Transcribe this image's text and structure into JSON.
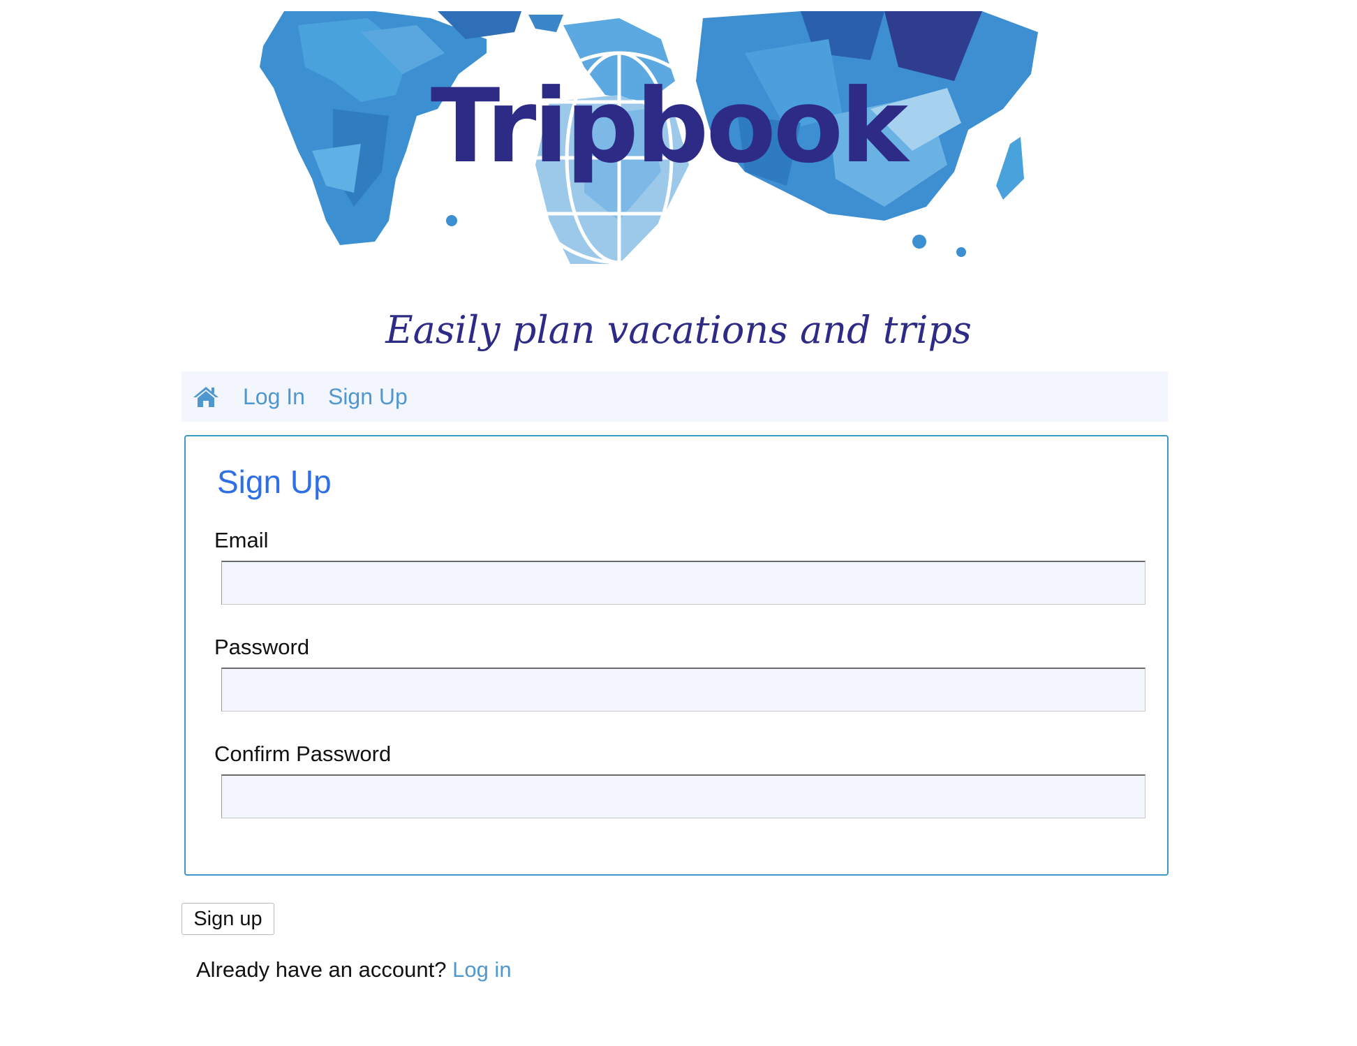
{
  "banner": {
    "logo_text": "Tripbook",
    "tagline": "Easily plan vacations and trips"
  },
  "nav": {
    "home_icon": "home-icon",
    "links": [
      {
        "label": "Log In"
      },
      {
        "label": "Sign Up"
      }
    ]
  },
  "form": {
    "title": "Sign Up",
    "fields": [
      {
        "label": "Email",
        "value": "",
        "placeholder": ""
      },
      {
        "label": "Password",
        "value": "",
        "placeholder": ""
      },
      {
        "label": "Confirm Password",
        "value": "",
        "placeholder": ""
      }
    ],
    "submit_label": "Sign up"
  },
  "footer": {
    "prompt": "Already have an account?",
    "link_label": "Log in"
  },
  "colors": {
    "brand_navy": "#2d2b86",
    "link_blue": "#4e97cf",
    "title_blue": "#2f6fe6",
    "card_border": "#3d97c8",
    "nav_bg": "#f3f6fc"
  }
}
